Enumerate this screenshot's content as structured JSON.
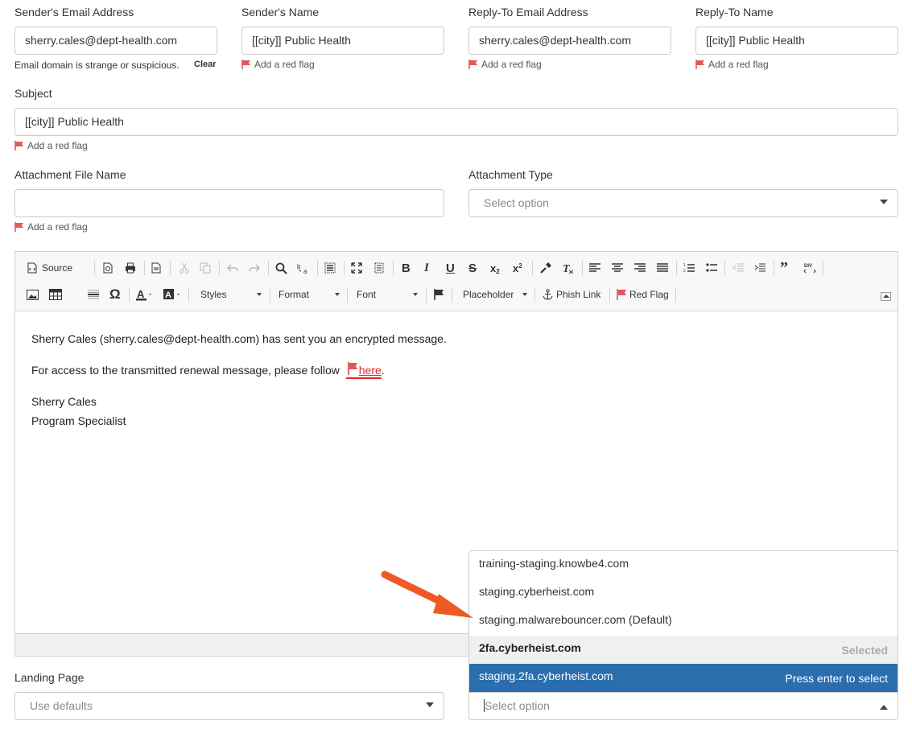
{
  "row1": {
    "sender_email": {
      "label": "Sender's Email Address",
      "value": "sherry.cales@dept-health.com"
    },
    "sender_name": {
      "label": "Sender's Name",
      "value": "[[city]] Public Health"
    },
    "reply_email": {
      "label": "Reply-To Email Address",
      "value": "sherry.cales@dept-health.com"
    },
    "reply_name": {
      "label": "Reply-To Name",
      "value": "[[city]] Public Health"
    },
    "email_hint": "Email domain is strange or suspicious.",
    "clear_label": "Clear"
  },
  "red_flag_label": "Add a red flag",
  "subject": {
    "label": "Subject",
    "value": "[[city]] Public Health"
  },
  "attachment": {
    "name_label": "Attachment File Name",
    "name_value": "",
    "type_label": "Attachment Type",
    "type_placeholder": "Select option"
  },
  "toolbar": {
    "source": "Source",
    "styles": "Styles",
    "format": "Format",
    "font": "Font",
    "placeholder": "Placeholder",
    "phish_link": "Phish Link",
    "red_flag": "Red Flag"
  },
  "body": {
    "line1": "Sherry Cales (sherry.cales@dept-health.com) has sent you an encrypted message.",
    "line2_pre": "For access to the transmitted renewal message, please follow ",
    "line2_link": "here",
    "line2_post": ".",
    "sig_name": "Sherry Cales",
    "sig_title": "Program Specialist"
  },
  "landing": {
    "label": "Landing Page",
    "placeholder": "Use defaults"
  },
  "domain_select": {
    "placeholder": "Select option",
    "options": [
      {
        "label": "training-staging.knowbe4.com"
      },
      {
        "label": "staging.cyberheist.com"
      },
      {
        "label": "staging.malwarebouncer.com (Default)"
      },
      {
        "label": "2fa.cyberheist.com",
        "tag": "Selected"
      },
      {
        "label": "staging.2fa.cyberheist.com",
        "tag": "Press enter to select"
      }
    ]
  },
  "colors": {
    "flag": "#e0595b",
    "highlight": "#2a6ead",
    "arrow": "#ee5a24"
  }
}
